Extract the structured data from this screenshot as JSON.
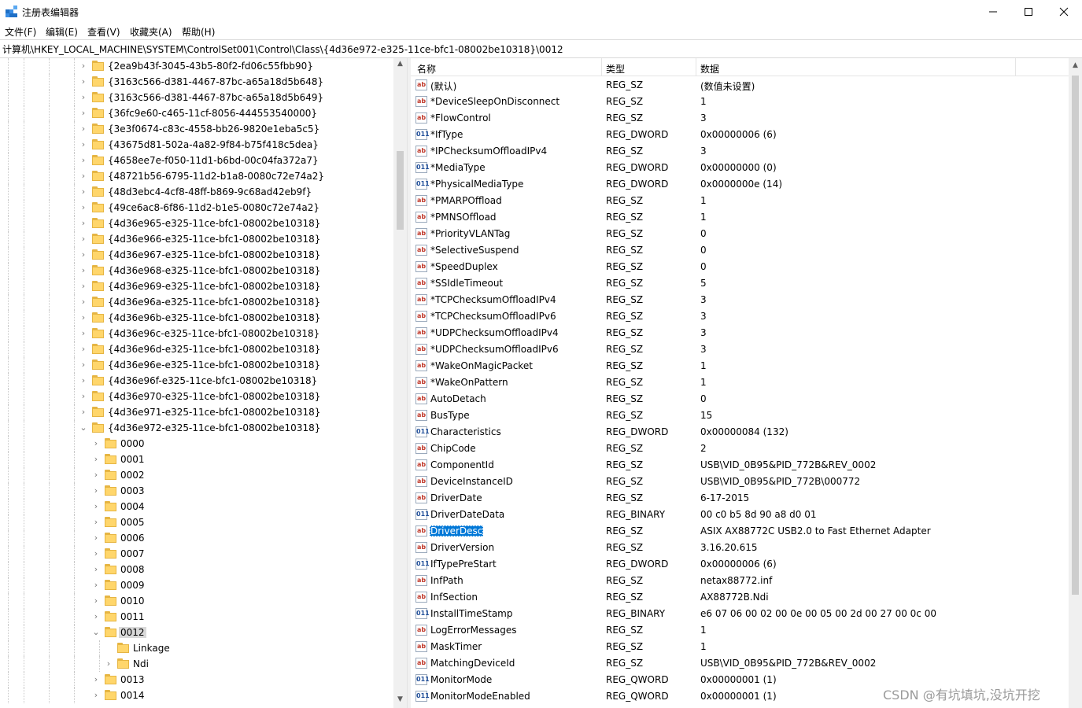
{
  "window": {
    "title": "注册表编辑器",
    "controls": {
      "minimize": "—",
      "maximize": "☐",
      "close": "✕"
    }
  },
  "menu": [
    "文件(F)",
    "编辑(E)",
    "查看(V)",
    "收藏夹(A)",
    "帮助(H)"
  ],
  "address": "计算机\\HKEY_LOCAL_MACHINE\\SYSTEM\\ControlSet001\\Control\\Class\\{4d36e972-e325-11ce-bfc1-08002be10318}\\0012",
  "tree": [
    {
      "label": "{2ea9b43f-3045-43b5-80f2-fd06c55fbb90}",
      "level": 1,
      "chevron": "right"
    },
    {
      "label": "{3163c566-d381-4467-87bc-a65a18d5b648}",
      "level": 1,
      "chevron": "right"
    },
    {
      "label": "{3163c566-d381-4467-87bc-a65a18d5b649}",
      "level": 1,
      "chevron": "right"
    },
    {
      "label": "{36fc9e60-c465-11cf-8056-444553540000}",
      "level": 1,
      "chevron": "right"
    },
    {
      "label": "{3e3f0674-c83c-4558-bb26-9820e1eba5c5}",
      "level": 1,
      "chevron": "right"
    },
    {
      "label": "{43675d81-502a-4a82-9f84-b75f418c5dea}",
      "level": 1,
      "chevron": "right"
    },
    {
      "label": "{4658ee7e-f050-11d1-b6bd-00c04fa372a7}",
      "level": 1,
      "chevron": "right"
    },
    {
      "label": "{48721b56-6795-11d2-b1a8-0080c72e74a2}",
      "level": 1,
      "chevron": "right"
    },
    {
      "label": "{48d3ebc4-4cf8-48ff-b869-9c68ad42eb9f}",
      "level": 1,
      "chevron": "right"
    },
    {
      "label": "{49ce6ac8-6f86-11d2-b1e5-0080c72e74a2}",
      "level": 1,
      "chevron": "right"
    },
    {
      "label": "{4d36e965-e325-11ce-bfc1-08002be10318}",
      "level": 1,
      "chevron": "right"
    },
    {
      "label": "{4d36e966-e325-11ce-bfc1-08002be10318}",
      "level": 1,
      "chevron": "right"
    },
    {
      "label": "{4d36e967-e325-11ce-bfc1-08002be10318}",
      "level": 1,
      "chevron": "right"
    },
    {
      "label": "{4d36e968-e325-11ce-bfc1-08002be10318}",
      "level": 1,
      "chevron": "right"
    },
    {
      "label": "{4d36e969-e325-11ce-bfc1-08002be10318}",
      "level": 1,
      "chevron": "right"
    },
    {
      "label": "{4d36e96a-e325-11ce-bfc1-08002be10318}",
      "level": 1,
      "chevron": "right"
    },
    {
      "label": "{4d36e96b-e325-11ce-bfc1-08002be10318}",
      "level": 1,
      "chevron": "right"
    },
    {
      "label": "{4d36e96c-e325-11ce-bfc1-08002be10318}",
      "level": 1,
      "chevron": "right"
    },
    {
      "label": "{4d36e96d-e325-11ce-bfc1-08002be10318}",
      "level": 1,
      "chevron": "right"
    },
    {
      "label": "{4d36e96e-e325-11ce-bfc1-08002be10318}",
      "level": 1,
      "chevron": "right"
    },
    {
      "label": "{4d36e96f-e325-11ce-bfc1-08002be10318}",
      "level": 1,
      "chevron": "right"
    },
    {
      "label": "{4d36e970-e325-11ce-bfc1-08002be10318}",
      "level": 1,
      "chevron": "right"
    },
    {
      "label": "{4d36e971-e325-11ce-bfc1-08002be10318}",
      "level": 1,
      "chevron": "right"
    },
    {
      "label": "{4d36e972-e325-11ce-bfc1-08002be10318}",
      "level": 1,
      "chevron": "down"
    },
    {
      "label": "0000",
      "level": 2,
      "chevron": "right"
    },
    {
      "label": "0001",
      "level": 2,
      "chevron": "right"
    },
    {
      "label": "0002",
      "level": 2,
      "chevron": "right"
    },
    {
      "label": "0003",
      "level": 2,
      "chevron": "right"
    },
    {
      "label": "0004",
      "level": 2,
      "chevron": "right"
    },
    {
      "label": "0005",
      "level": 2,
      "chevron": "right"
    },
    {
      "label": "0006",
      "level": 2,
      "chevron": "right"
    },
    {
      "label": "0007",
      "level": 2,
      "chevron": "right"
    },
    {
      "label": "0008",
      "level": 2,
      "chevron": "right"
    },
    {
      "label": "0009",
      "level": 2,
      "chevron": "right"
    },
    {
      "label": "0010",
      "level": 2,
      "chevron": "right"
    },
    {
      "label": "0011",
      "level": 2,
      "chevron": "right"
    },
    {
      "label": "0012",
      "level": 2,
      "chevron": "down",
      "selected": true
    },
    {
      "label": "Linkage",
      "level": 3,
      "chevron": "none"
    },
    {
      "label": "Ndi",
      "level": 3,
      "chevron": "right"
    },
    {
      "label": "0013",
      "level": 2,
      "chevron": "right"
    },
    {
      "label": "0014",
      "level": 2,
      "chevron": "right"
    }
  ],
  "columns": {
    "name": "名称",
    "type": "类型",
    "data": "数据"
  },
  "values": [
    {
      "name": "(默认)",
      "type": "REG_SZ",
      "data": "(数值未设置)",
      "icon": "sz"
    },
    {
      "name": "*DeviceSleepOnDisconnect",
      "type": "REG_SZ",
      "data": "1",
      "icon": "sz"
    },
    {
      "name": "*FlowControl",
      "type": "REG_SZ",
      "data": "3",
      "icon": "sz"
    },
    {
      "name": "*IfType",
      "type": "REG_DWORD",
      "data": "0x00000006 (6)",
      "icon": "bin"
    },
    {
      "name": "*IPChecksumOffloadIPv4",
      "type": "REG_SZ",
      "data": "3",
      "icon": "sz"
    },
    {
      "name": "*MediaType",
      "type": "REG_DWORD",
      "data": "0x00000000 (0)",
      "icon": "bin"
    },
    {
      "name": "*PhysicalMediaType",
      "type": "REG_DWORD",
      "data": "0x0000000e (14)",
      "icon": "bin"
    },
    {
      "name": "*PMARPOffload",
      "type": "REG_SZ",
      "data": "1",
      "icon": "sz"
    },
    {
      "name": "*PMNSOffload",
      "type": "REG_SZ",
      "data": "1",
      "icon": "sz"
    },
    {
      "name": "*PriorityVLANTag",
      "type": "REG_SZ",
      "data": "0",
      "icon": "sz"
    },
    {
      "name": "*SelectiveSuspend",
      "type": "REG_SZ",
      "data": "0",
      "icon": "sz"
    },
    {
      "name": "*SpeedDuplex",
      "type": "REG_SZ",
      "data": "0",
      "icon": "sz"
    },
    {
      "name": "*SSIdleTimeout",
      "type": "REG_SZ",
      "data": "5",
      "icon": "sz"
    },
    {
      "name": "*TCPChecksumOffloadIPv4",
      "type": "REG_SZ",
      "data": "3",
      "icon": "sz"
    },
    {
      "name": "*TCPChecksumOffloadIPv6",
      "type": "REG_SZ",
      "data": "3",
      "icon": "sz"
    },
    {
      "name": "*UDPChecksumOffloadIPv4",
      "type": "REG_SZ",
      "data": "3",
      "icon": "sz"
    },
    {
      "name": "*UDPChecksumOffloadIPv6",
      "type": "REG_SZ",
      "data": "3",
      "icon": "sz"
    },
    {
      "name": "*WakeOnMagicPacket",
      "type": "REG_SZ",
      "data": "1",
      "icon": "sz"
    },
    {
      "name": "*WakeOnPattern",
      "type": "REG_SZ",
      "data": "1",
      "icon": "sz"
    },
    {
      "name": "AutoDetach",
      "type": "REG_SZ",
      "data": "0",
      "icon": "sz"
    },
    {
      "name": "BusType",
      "type": "REG_SZ",
      "data": "15",
      "icon": "sz"
    },
    {
      "name": "Characteristics",
      "type": "REG_DWORD",
      "data": "0x00000084 (132)",
      "icon": "bin"
    },
    {
      "name": "ChipCode",
      "type": "REG_SZ",
      "data": "2",
      "icon": "sz"
    },
    {
      "name": "ComponentId",
      "type": "REG_SZ",
      "data": "USB\\VID_0B95&PID_772B&REV_0002",
      "icon": "sz"
    },
    {
      "name": "DeviceInstanceID",
      "type": "REG_SZ",
      "data": "USB\\VID_0B95&PID_772B\\000772",
      "icon": "sz"
    },
    {
      "name": "DriverDate",
      "type": "REG_SZ",
      "data": "6-17-2015",
      "icon": "sz"
    },
    {
      "name": "DriverDateData",
      "type": "REG_BINARY",
      "data": "00 c0 b5 8d 90 a8 d0 01",
      "icon": "bin"
    },
    {
      "name": "DriverDesc",
      "type": "REG_SZ",
      "data": "ASIX AX88772C USB2.0 to Fast Ethernet Adapter",
      "icon": "sz",
      "selected": true
    },
    {
      "name": "DriverVersion",
      "type": "REG_SZ",
      "data": "3.16.20.615",
      "icon": "sz"
    },
    {
      "name": "IfTypePreStart",
      "type": "REG_DWORD",
      "data": "0x00000006 (6)",
      "icon": "bin"
    },
    {
      "name": "InfPath",
      "type": "REG_SZ",
      "data": "netax88772.inf",
      "icon": "sz"
    },
    {
      "name": "InfSection",
      "type": "REG_SZ",
      "data": "AX88772B.Ndi",
      "icon": "sz"
    },
    {
      "name": "InstallTimeStamp",
      "type": "REG_BINARY",
      "data": "e6 07 06 00 02 00 0e 00 05 00 2d 00 27 00 0c 00",
      "icon": "bin"
    },
    {
      "name": "LogErrorMessages",
      "type": "REG_SZ",
      "data": "1",
      "icon": "sz"
    },
    {
      "name": "MaskTimer",
      "type": "REG_SZ",
      "data": "1",
      "icon": "sz"
    },
    {
      "name": "MatchingDeviceId",
      "type": "REG_SZ",
      "data": "USB\\VID_0B95&PID_772B&REV_0002",
      "icon": "sz"
    },
    {
      "name": "MonitorMode",
      "type": "REG_QWORD",
      "data": "0x00000001 (1)",
      "icon": "bin"
    },
    {
      "name": "MonitorModeEnabled",
      "type": "REG_QWORD",
      "data": "0x00000001 (1)",
      "icon": "bin"
    }
  ],
  "icon_text": {
    "sz": "ab",
    "bin": "011"
  },
  "watermark": "CSDN @有坑填坑,没坑开挖"
}
